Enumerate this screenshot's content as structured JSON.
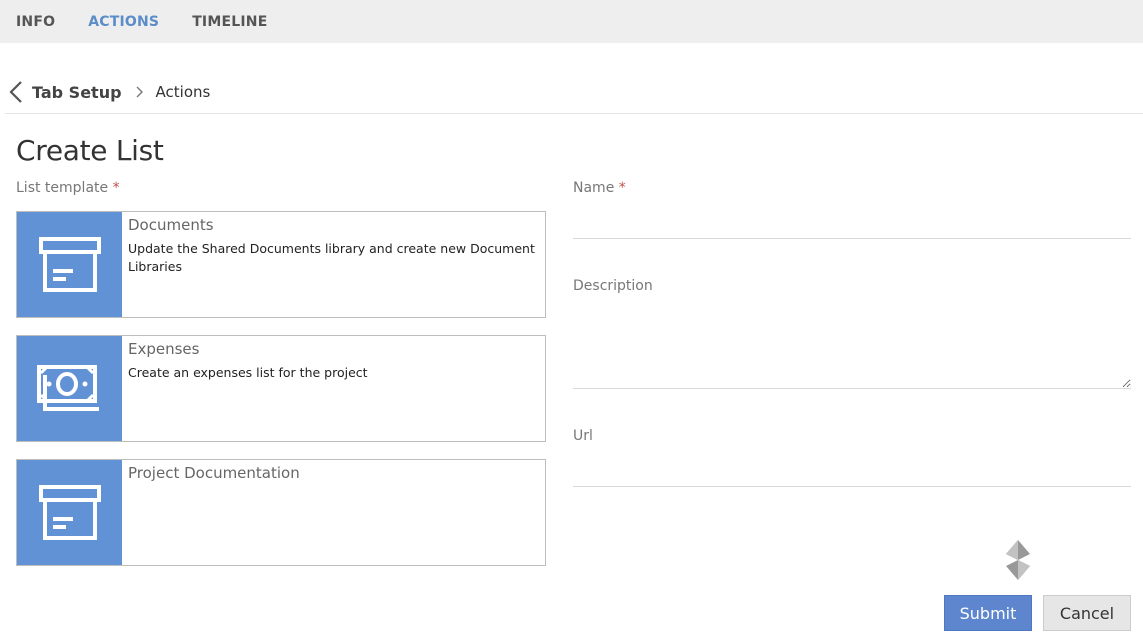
{
  "tabs": [
    {
      "label": "INFO",
      "active": false
    },
    {
      "label": "ACTIONS",
      "active": true
    },
    {
      "label": "TIMELINE",
      "active": false
    }
  ],
  "breadcrumb": {
    "root": "Tab Setup",
    "current": "Actions"
  },
  "page_title": "Create List",
  "list_template": {
    "label": "List template",
    "required_mark": "*",
    "items": [
      {
        "title": "Documents",
        "description": "Update the Shared Documents library and create new Document Libraries",
        "icon": "archive-box-icon"
      },
      {
        "title": "Expenses",
        "description": "Create an expenses list for the project",
        "icon": "banknotes-icon"
      },
      {
        "title": "Project Documentation",
        "description": "",
        "icon": "archive-box-icon"
      }
    ]
  },
  "form": {
    "name_label": "Name",
    "name_required_mark": "*",
    "name_value": "",
    "description_label": "Description",
    "description_value": "",
    "url_label": "Url",
    "url_value": ""
  },
  "buttons": {
    "submit": "Submit",
    "cancel": "Cancel"
  },
  "colors": {
    "accent": "#5b8dc9",
    "card_icon_bg": "#6292d6",
    "submit_bg": "#5d86cf",
    "required": "#c0504d"
  }
}
